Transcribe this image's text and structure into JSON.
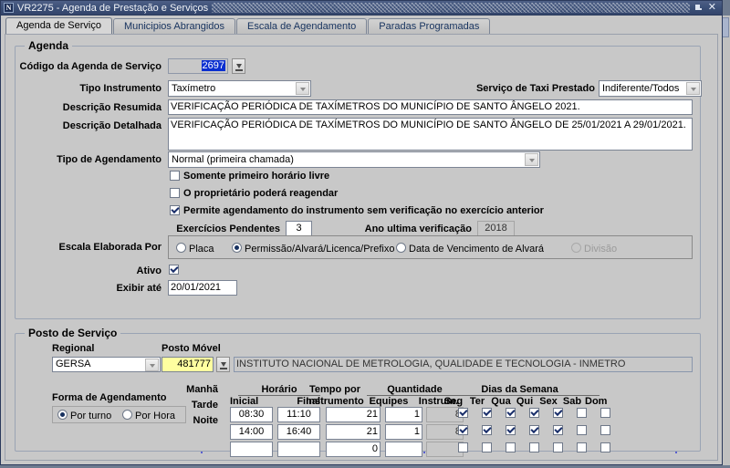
{
  "window": {
    "title": "VR2275 - Agenda de Prestação e Serviços",
    "icon": "app-icon",
    "minimize_label": "⤵",
    "close_label": "✕"
  },
  "tabs": [
    {
      "label": "Agenda de Serviço",
      "selected": true
    },
    {
      "label": "Municipios Abrangidos",
      "selected": false
    },
    {
      "label": "Escala de Agendamento",
      "selected": false
    },
    {
      "label": "Paradas Programadas",
      "selected": false
    }
  ],
  "agenda": {
    "group_title": "Agenda",
    "codigo_label": "Código da Agenda de Serviço",
    "codigo_value": "2697",
    "tipo_instrumento_label": "Tipo Instrumento",
    "tipo_instrumento_value": "Taxímetro",
    "servico_taxi_label": "Serviço de Taxi Prestado",
    "servico_taxi_value": "Indiferente/Todos",
    "desc_resumida_label": "Descrição Resumida",
    "desc_resumida_value": "VERIFICAÇÃO PERIÓDICA DE TAXÍMETROS DO MUNICÍPIO DE SANTO ÂNGELO 2021.",
    "desc_detalhada_label": "Descrição Detalhada",
    "desc_detalhada_value": "VERIFICAÇÃO PERIÓDICA DE TAXÍMETROS DO MUNICÍPIO DE SANTO ÂNGELO DE 25/01/2021 A 29/01/2021.",
    "tipo_agendamento_label": "Tipo de Agendamento",
    "tipo_agendamento_value": "Normal (primeira chamada)",
    "somente_primeiro_label": "Somente primeiro horário livre",
    "somente_primeiro_checked": false,
    "proprietario_label": "O proprietário poderá reagendar",
    "proprietario_checked": false,
    "permite_label": "Permite agendamento do instrumento sem verificação no exercício anterior",
    "permite_checked": true,
    "exercicios_label": "Exercícios Pendentes",
    "exercicios_value": "3",
    "ano_ultima_label": "Ano ultima verificação",
    "ano_ultima_value": "2018",
    "escala_label": "Escala Elaborada Por",
    "escala_options": [
      {
        "label": "Placa",
        "selected": false,
        "disabled": false
      },
      {
        "label": "Permissão/Alvará/Licenca/Prefixo",
        "selected": true,
        "disabled": false
      },
      {
        "label": "Data de Vencimento de Alvará",
        "selected": false,
        "disabled": false
      },
      {
        "label": "Divisão",
        "selected": false,
        "disabled": true
      }
    ],
    "ativo_label": "Ativo",
    "ativo_checked": true,
    "exibir_ate_label": "Exibir até",
    "exibir_ate_value": "20/01/2021"
  },
  "posto": {
    "group_title": "Posto de Serviço",
    "regional_label": "Regional",
    "regional_value": "GERSA",
    "posto_movel_label": "Posto Móvel",
    "posto_movel_code": "481777",
    "posto_movel_name": "INSTITUTO NACIONAL DE METROLOGIA, QUALIDADE E TECNOLOGIA - INMETRO",
    "forma_label": "Forma de Agendamento",
    "forma_options": [
      {
        "label": "Por turno",
        "selected": true
      },
      {
        "label": "Por Hora",
        "selected": false
      }
    ],
    "headers": {
      "horario": "Horário",
      "inicial": "Inicial",
      "final": "Final",
      "tempo_por": "Tempo por",
      "instrumento": "Instrumento",
      "quantidade": "Quantidade",
      "equipes": "Equipes",
      "instrum": "Instrum.",
      "dias_semana": "Dias da Semana"
    },
    "weekdays": [
      "Seg",
      "Ter",
      "Qua",
      "Qui",
      "Sex",
      "Sab",
      "Dom"
    ],
    "shift_labels": [
      "Manhã",
      "Tarde",
      "Noite"
    ],
    "rows": [
      {
        "inicial": "08:30",
        "final": "11:10",
        "tempo": "21",
        "equipes": "1",
        "instrum": "8",
        "days": [
          true,
          true,
          true,
          true,
          true,
          false,
          false
        ]
      },
      {
        "inicial": "14:00",
        "final": "16:40",
        "tempo": "21",
        "equipes": "1",
        "instrum": "8",
        "days": [
          true,
          true,
          true,
          true,
          true,
          false,
          false
        ]
      },
      {
        "inicial": "",
        "final": "",
        "tempo": "0",
        "equipes": "",
        "instrum": "",
        "days": [
          false,
          false,
          false,
          false,
          false,
          false,
          false
        ]
      }
    ]
  },
  "colors": {
    "titlebar": "#3d5179",
    "face": "#c8c8c8",
    "highlight": "#0a2fd0",
    "yellow_field": "#ffffa0",
    "desktop": "#6e7b8f"
  }
}
